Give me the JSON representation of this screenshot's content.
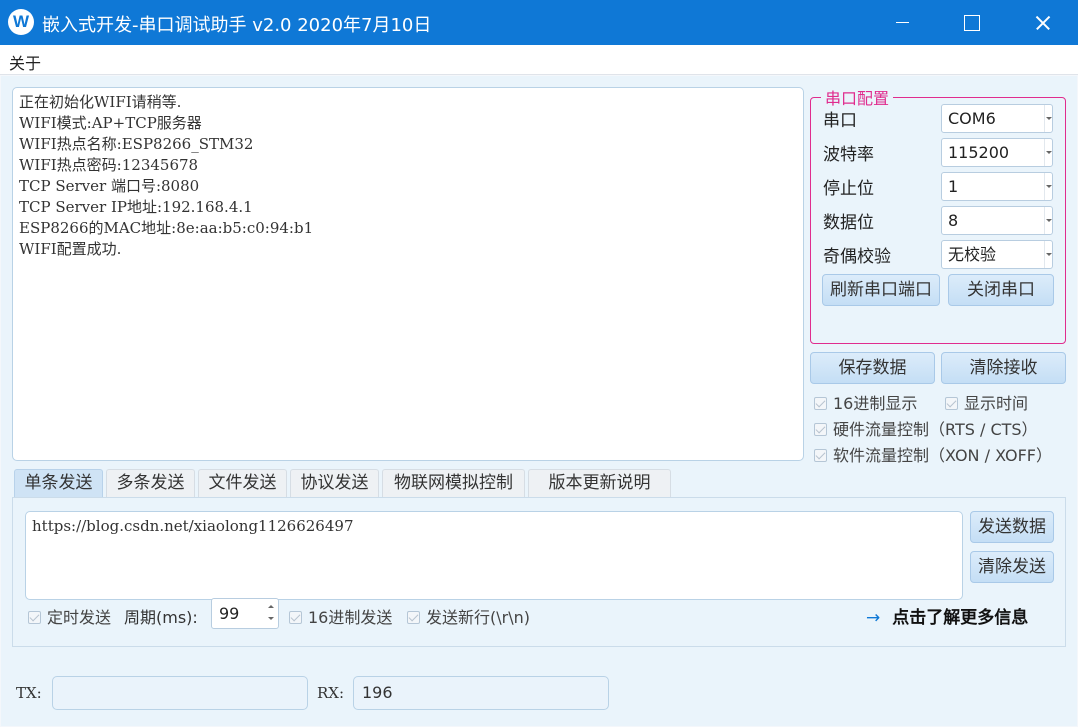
{
  "window": {
    "title": "嵌入式开发-串口调试助手 v2.0 2020年7月10日",
    "icon_letter": "W",
    "accent_color": "#0f78d6"
  },
  "menu": {
    "about": "关于"
  },
  "receive": {
    "text": "正在初始化WIFI请稍等.\nWIFI模式:AP+TCP服务器\nWIFI热点名称:ESP8266_STM32\nWIFI热点密码:12345678\nTCP Server 端口号:8080\nTCP Server IP地址:192.168.4.1\nESP8266的MAC地址:8e:aa:b5:c0:94:b1\nWIFI配置成功."
  },
  "port_config": {
    "legend": "串口配置",
    "legend_color": "#e02c8e",
    "port": {
      "label": "串口",
      "value": "COM6"
    },
    "baud": {
      "label": "波特率",
      "value": "115200"
    },
    "stop_bits": {
      "label": "停止位",
      "value": "1"
    },
    "data_bits": {
      "label": "数据位",
      "value": "8"
    },
    "parity": {
      "label": "奇偶校验",
      "value": "无校验"
    },
    "refresh_button": "刷新串口端口",
    "close_button": "关闭串口"
  },
  "actions": {
    "save_button": "保存数据",
    "clear_receive_button": "清除接收"
  },
  "options": {
    "hex_display": "16进制显示",
    "show_time": "显示时间",
    "hw_flow": "硬件流量控制（RTS / CTS）",
    "sw_flow": "软件流量控制（XON / XOFF）"
  },
  "tabs": [
    "单条发送",
    "多条发送",
    "文件发送",
    "协议发送",
    "物联网模拟控制",
    "版本更新说明"
  ],
  "send": {
    "text": "https://blog.csdn.net/xiaolong1126626497",
    "send_button": "发送数据",
    "clear_button": "清除发送",
    "timed_send": "定时发送",
    "period_label": "周期(ms):",
    "period_value": "99",
    "hex_send": "16进制发送",
    "newline": "发送新行(\\r\\n)",
    "more_info": "点击了解更多信息",
    "more_info_icon": "arrow-right-icon"
  },
  "status": {
    "tx_label": "TX:",
    "tx_value": "",
    "rx_label": "RX:",
    "rx_value": "196"
  }
}
